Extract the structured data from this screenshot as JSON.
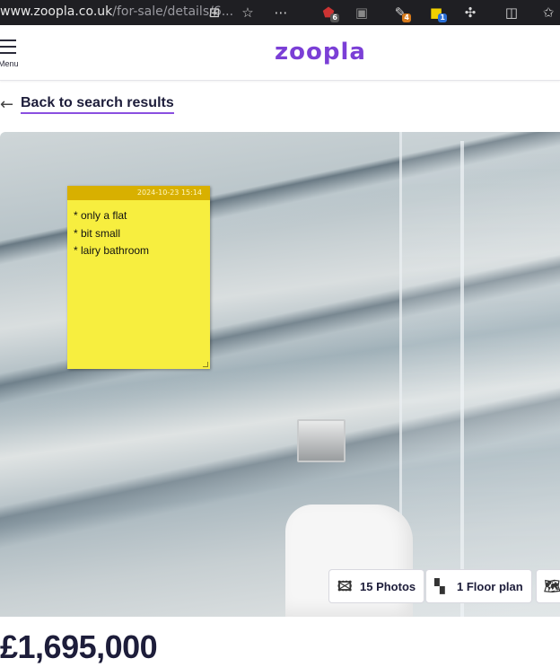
{
  "browser": {
    "url_domain": "www.zoopla.co.uk",
    "url_path": "/for-sale/details/6...",
    "icons": [
      "grid-icon",
      "star-icon",
      "more-icon",
      "ublock-icon",
      "extension-icon",
      "extension-icon",
      "sticky-notes-icon",
      "puzzle-icon",
      "split-icon",
      "favorites-icon"
    ],
    "badges": {
      "ublock": "6",
      "ext2": "4",
      "notes": "1"
    }
  },
  "header": {
    "menu_label": "Menu",
    "logo": "zoopla"
  },
  "back_link": {
    "label": "Back to search results"
  },
  "sticky_note": {
    "timestamp": "2024-10-23 15:14",
    "lines": [
      "* only a flat",
      "* bit small",
      "* lairy bathroom"
    ]
  },
  "gallery": {
    "photos_button": "15 Photos",
    "floorplan_button": "1 Floor plan"
  },
  "listing": {
    "price": "£1,695,000"
  },
  "colors": {
    "brand": "#7b3fd6",
    "note": "#f7ee3f",
    "note_header": "#d8b000"
  }
}
